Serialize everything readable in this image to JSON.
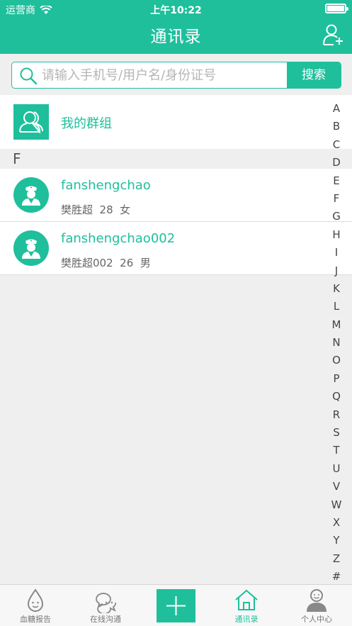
{
  "status_bar": {
    "carrier": "运营商",
    "time": "上午10:22"
  },
  "header": {
    "title": "通讯录"
  },
  "search": {
    "placeholder": "请输入手机号/用户名/身份证号",
    "button_label": "搜索"
  },
  "group": {
    "label": "我的群组"
  },
  "sections": [
    {
      "letter": "F",
      "contacts": [
        {
          "name": "fanshengchao",
          "info": "樊胜超  28  女"
        },
        {
          "name": "fanshengchao002",
          "info": "樊胜超002  26  男"
        }
      ]
    }
  ],
  "index_letters": [
    "A",
    "B",
    "C",
    "D",
    "E",
    "F",
    "G",
    "H",
    "I",
    "J",
    "K",
    "L",
    "M",
    "N",
    "O",
    "P",
    "Q",
    "R",
    "S",
    "T",
    "U",
    "V",
    "W",
    "X",
    "Y",
    "Z",
    "#"
  ],
  "tabs": [
    {
      "label": "血糖报告",
      "icon": "blood-drop-icon"
    },
    {
      "label": "在线沟通",
      "icon": "chat-icon"
    },
    {
      "label": "",
      "icon": "plus-icon"
    },
    {
      "label": "通讯录",
      "icon": "home-icon"
    },
    {
      "label": "个人中心",
      "icon": "person-icon"
    }
  ],
  "colors": {
    "brand": "#1fbf9c",
    "background": "#efefef",
    "text_secondary": "#666666"
  }
}
